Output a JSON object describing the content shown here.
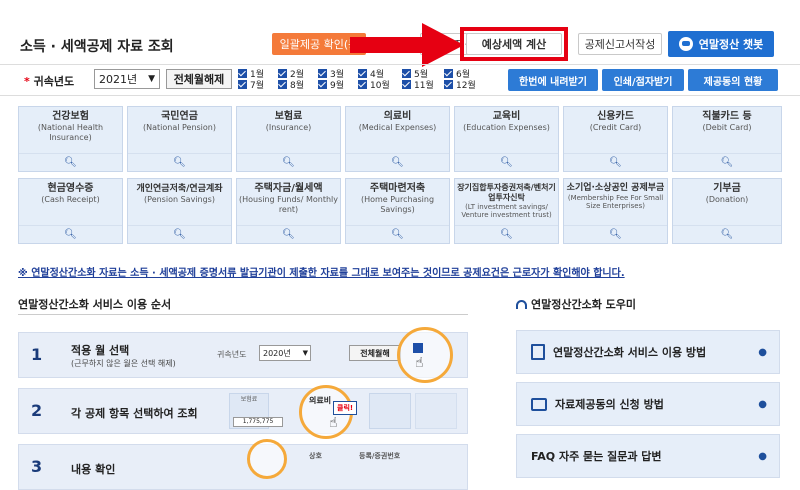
{
  "header": {
    "title": "소득 · 세액공제 자료 조회",
    "buttons": {
      "bulk_confirm": "일괄제공 확인(동",
      "partial": "제공",
      "tax_estimate": "예상세액 계산",
      "tax_form": "공제신고서작성",
      "chatbot": "연말정산 챗봇"
    }
  },
  "filters": {
    "year_label": "귀속년도",
    "year_star": "*",
    "year_value": "2021년",
    "all_button": "전체월해제",
    "months": [
      "1월",
      "2월",
      "3월",
      "4월",
      "5월",
      "6월",
      "7월",
      "8월",
      "9월",
      "10월",
      "11월",
      "12월"
    ],
    "download_all": "한번에 내려받기",
    "print": "인쇄/점자받기",
    "consent_status": "제공동의 현황"
  },
  "categories": [
    {
      "ko": "건강보험",
      "en": "(National Health Insurance)"
    },
    {
      "ko": "국민연금",
      "en": "(National Pension)"
    },
    {
      "ko": "보험료",
      "en": "(Insurance)"
    },
    {
      "ko": "의료비",
      "en": "(Medical Expenses)"
    },
    {
      "ko": "교육비",
      "en": "(Education Expenses)"
    },
    {
      "ko": "신용카드",
      "en": "(Credit Card)"
    },
    {
      "ko": "직불카드 등",
      "en": "(Debit Card)"
    },
    {
      "ko": "현금영수증",
      "en": "(Cash Receipt)"
    },
    {
      "ko": "개인연금저축/연금계좌",
      "en": "(Pension Savings)"
    },
    {
      "ko": "주택자금/월세액",
      "en": "(Housing Funds/ Monthly rent)"
    },
    {
      "ko": "주택마련저축",
      "en": "(Home Purchasing Savings)"
    },
    {
      "ko": "장기집합투자증권저축/벤처기업투자신탁",
      "en": "(LT investment savings/ Venture investment trust)"
    },
    {
      "ko": "소기업·소상공인 공제부금",
      "en": "(Membership Fee For Small Size Enterprises)"
    },
    {
      "ko": "기부금",
      "en": "(Donation)"
    }
  ],
  "notice": "※ 연말정산간소화 자료는 소득 · 세액공제 증명서류 발급기관이 제출한 자료를 그대로 보여주는 것이므로 공제요건은 근로자가 확인해야 합니다.",
  "steps_section": {
    "title": "연말정산간소화 서비스 이용 순서",
    "steps": [
      {
        "num": "1",
        "title": "적용 월 선택",
        "sub": "(근무하지 않은 월은 선택 해제)"
      },
      {
        "num": "2",
        "title": "각 공제 항목 선택하여 조회",
        "sub": ""
      },
      {
        "num": "3",
        "title": "내용 확인",
        "sub": ""
      }
    ],
    "demo": {
      "year_label": "귀속년도",
      "year_value": "2020년",
      "all_button": "전체월해",
      "medical": "의료비",
      "click": "클릭!",
      "amount": "1,775,775",
      "name": "상호",
      "biz_no": "등록/증권번호"
    }
  },
  "help_section": {
    "title": "연말정산간소화 도우미",
    "items": [
      "연말정산간소화 서비스 이용 방법",
      "자료제공동의 신청 방법",
      "FAQ 자주 묻는 질문과 답변"
    ]
  },
  "colors": {
    "accent_blue": "#1f6fd1",
    "orange": "#f47a3a",
    "highlight_red": "#e60012"
  }
}
